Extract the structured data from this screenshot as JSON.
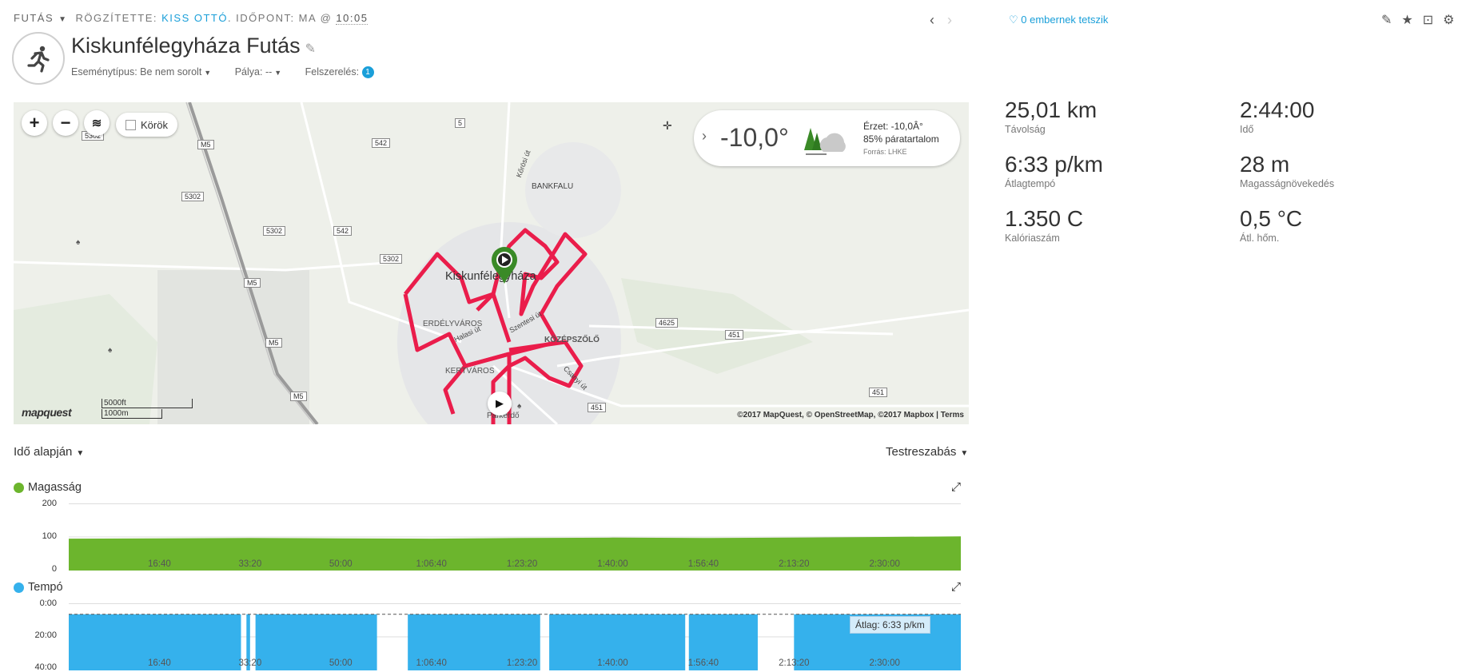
{
  "header": {
    "activity_type": "FUTÁS",
    "recorded_by_label": "RÖGZÍTETTE:",
    "recorded_by_name": "KISS OTTÓ",
    "time_label": ". IDŐPONT: MA @",
    "time_value": "10:05",
    "title": "Kiskunfélegyháza Futás",
    "event_type_label": "Eseménytípus:",
    "event_type_value": "Be nem sorolt",
    "course_label": "Pálya:",
    "course_value": "--",
    "gear_label": "Felszerelés:",
    "gear_count": "1",
    "likes": "0 embernek tetszik"
  },
  "map": {
    "laps_label": "Körök",
    "weather": {
      "temp": "-10,0°",
      "feels": "Érzet: -10,0Â°",
      "humidity": "85% páratartalom",
      "source": "Forrás: LHKE"
    },
    "labels": {
      "city": "Kiskunfélegyháza",
      "bankfalu": "BANKFALU",
      "erdelyvaros": "ERDÉLYVÁROS",
      "kozeszolo": "KÖZÉPSZŐLŐ",
      "kertvaros": "KERTVÁROS",
      "parkerdo": "Parkerdő",
      "halasi": "Halasi út",
      "szentesi": "Szentesi út",
      "koroi": "Kőrösi út",
      "csanyi": "Csanyi út",
      "r5302a": "5302",
      "r5302b": "5302",
      "r5302c": "5302",
      "r5302d": "5302",
      "m5a": "M5",
      "m5b": "M5",
      "m5c": "M5",
      "m5d": "M5",
      "r542a": "542",
      "r542b": "542",
      "r5": "5",
      "r4625": "4625",
      "r451a": "451",
      "r451b": "451",
      "r451c": "451"
    },
    "scale_ft": "5000ft",
    "scale_m": "1000m",
    "logo": "mapquest",
    "attribution": "©2017 MapQuest, © OpenStreetMap, ©2017 Mapbox | Terms"
  },
  "stats": [
    {
      "value": "25,01 km",
      "label": "Távolság"
    },
    {
      "value": "2:44:00",
      "label": "Idő"
    },
    {
      "value": "6:33 p/km",
      "label": "Átlagtempó"
    },
    {
      "value": "28 m",
      "label": "Magasságnövekedés"
    },
    {
      "value": "1.350 C",
      "label": "Kalóriaszám"
    },
    {
      "value": "0,5 °C",
      "label": "Átl. hőm."
    }
  ],
  "charts": {
    "x_mode": "Idő alapján",
    "customize": "Testreszabás",
    "colors": {
      "elevation": "#6cb52d",
      "pace": "#35b1ec"
    }
  },
  "chart_data": [
    {
      "type": "area",
      "title": "Magasság",
      "y_ticks": [
        "200",
        "100",
        "0"
      ],
      "ylim": [
        0,
        200
      ],
      "x_ticks": [
        "16:40",
        "33:20",
        "50:00",
        "1:06:40",
        "1:23:20",
        "1:40:00",
        "1:56:40",
        "2:13:20",
        "2:30:00"
      ],
      "x_tick_seconds": [
        1000,
        2000,
        3000,
        4000,
        5000,
        6000,
        7000,
        8000,
        9000
      ],
      "xlim_seconds": [
        0,
        9840
      ],
      "series": [
        {
          "x_seconds": [
            0,
            1000,
            2000,
            3000,
            4000,
            5000,
            6000,
            7000,
            8000,
            9000,
            9840
          ],
          "values": [
            95,
            96,
            97,
            96,
            95,
            97,
            98,
            97,
            98,
            100,
            102
          ]
        }
      ]
    },
    {
      "type": "area",
      "title": "Tempó",
      "y_ticks": [
        "0:00",
        "20:00",
        "40:00"
      ],
      "ylim_min_per_km": [
        0,
        40
      ],
      "average_label": "Átlag: 6:33 p/km",
      "average_min_per_km": 6.55,
      "x_ticks": [
        "16:40",
        "33:20",
        "50:00",
        "1:06:40",
        "1:23:20",
        "1:40:00",
        "1:56:40",
        "2:13:20",
        "2:30:00"
      ],
      "x_tick_seconds": [
        1000,
        2000,
        3000,
        4000,
        5000,
        6000,
        7000,
        8000,
        9000
      ],
      "xlim_seconds": [
        0,
        9840
      ],
      "series": [
        {
          "segments_seconds": [
            [
              0,
              1900
            ],
            [
              1960,
              2000
            ],
            [
              2060,
              3400
            ],
            [
              3740,
              5200
            ],
            [
              5300,
              6800
            ],
            [
              6840,
              7600
            ],
            [
              8000,
              9840
            ]
          ],
          "values_min_per_km": 6.55
        }
      ]
    }
  ]
}
